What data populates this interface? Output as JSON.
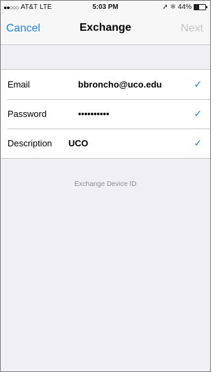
{
  "status_bar": {
    "signal_dots": "●●○○○",
    "carrier": "AT&T",
    "network": "LTE",
    "time": "5:03 PM",
    "location_icon": "➚",
    "bluetooth_icon": "✱",
    "battery_percent": "44%",
    "battery_level": 0.44
  },
  "nav": {
    "cancel_label": "Cancel",
    "title": "Exchange",
    "next_label": "Next"
  },
  "form": {
    "rows": [
      {
        "label": "Email",
        "value": "bbroncho@uco.edu",
        "check": "✓"
      },
      {
        "label": "Password",
        "value": "••••••••••",
        "check": "✓"
      },
      {
        "label": "Description",
        "value": "UCO",
        "check": "✓"
      }
    ]
  },
  "footer": {
    "device_id_label": "Exchange Device ID"
  },
  "colors": {
    "accent": "#1a82fb",
    "disabled": "#c7c7cc",
    "background": "#efeff4"
  }
}
